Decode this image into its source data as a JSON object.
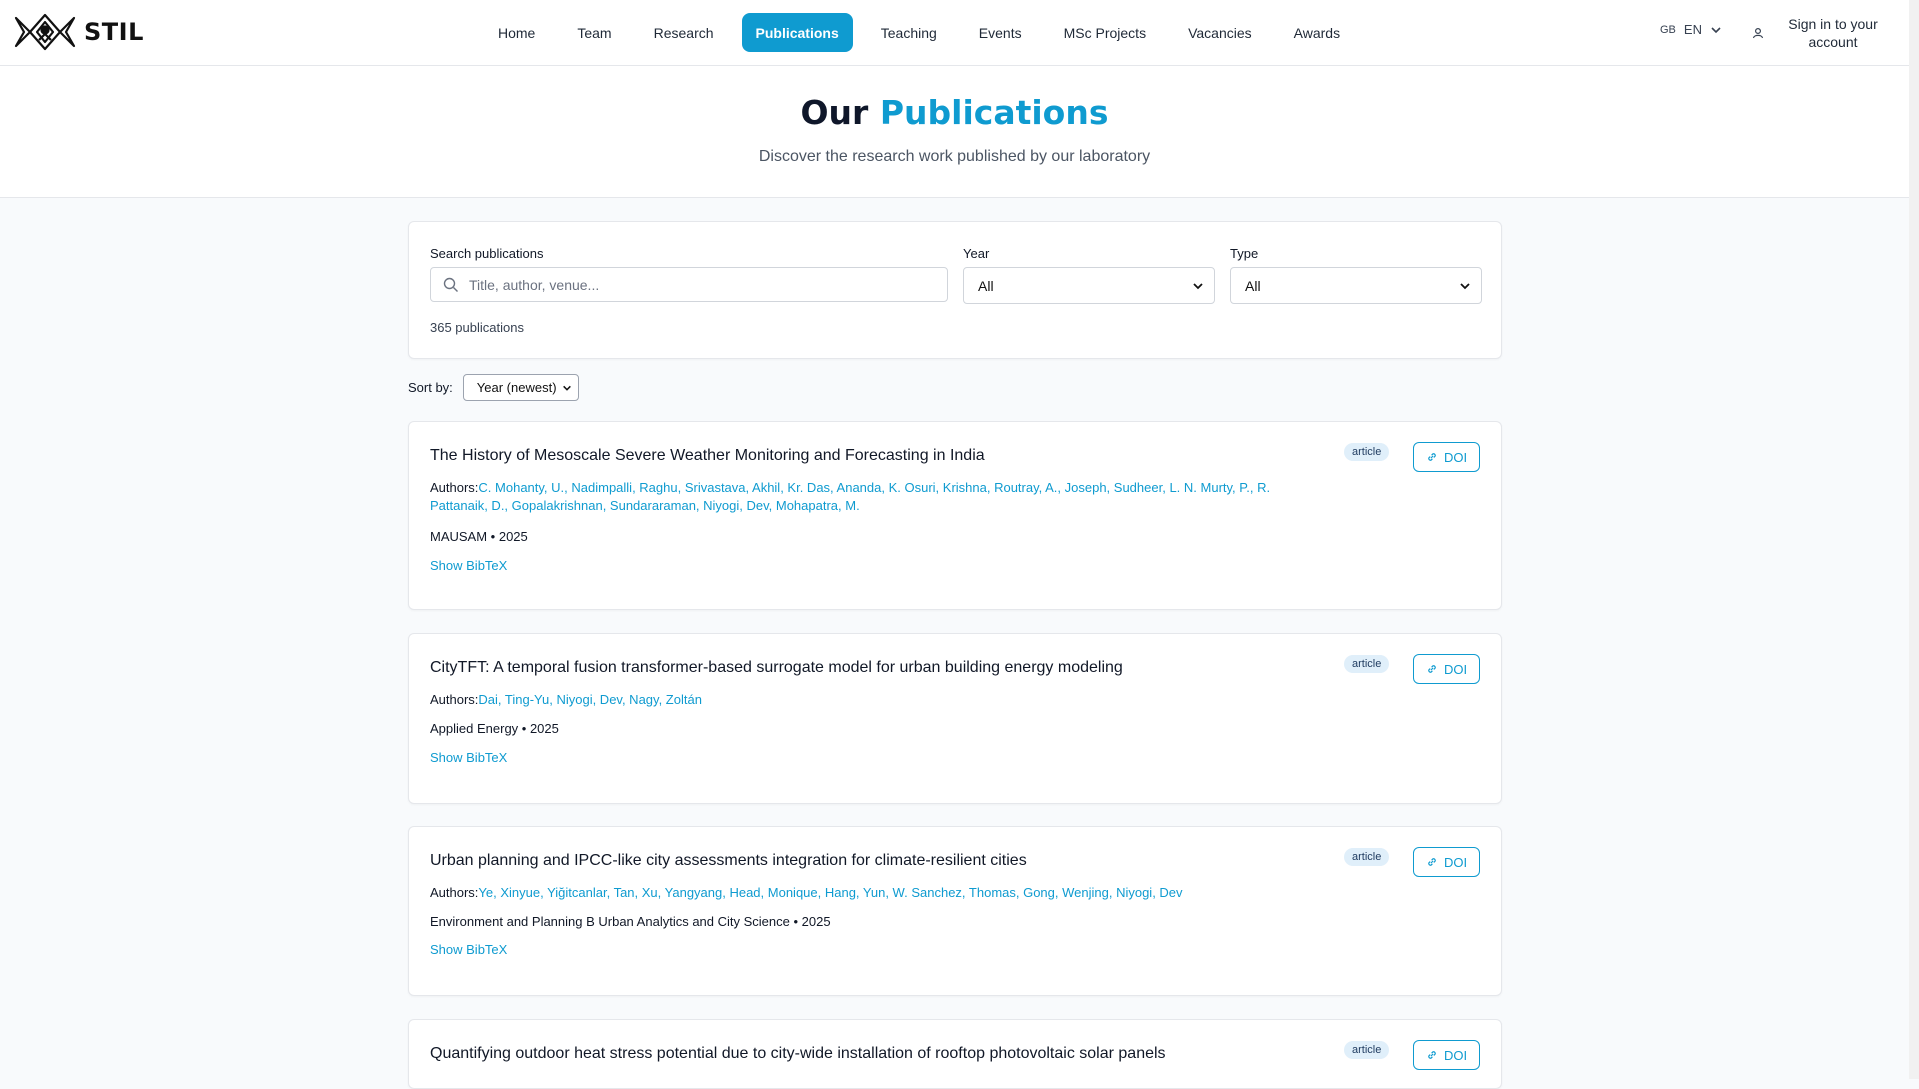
{
  "nav": {
    "brand": "STIL",
    "links": [
      "Home",
      "Team",
      "Research",
      "Publications",
      "Teaching",
      "Events",
      "MSc Projects",
      "Vacancies",
      "Awards"
    ],
    "active": "Publications",
    "lang_flag": "GB",
    "lang_code": "EN",
    "signin_line1": "Sign in to your",
    "signin_line2": "account"
  },
  "hero": {
    "title_prefix": "Our",
    "title_accent": "Publications",
    "subtitle": "Discover the research work published by our laboratory"
  },
  "filters": {
    "search_label": "Search publications",
    "search_placeholder": "Title, author, venue...",
    "year_label": "Year",
    "year_value": "All",
    "type_label": "Type",
    "type_value": "All",
    "count_text": "365 publications"
  },
  "sort": {
    "label": "Sort by:",
    "value": "Year (newest)"
  },
  "publications": [
    {
      "title": "The History of Mesoscale Severe Weather Monitoring and Forecasting in India",
      "authors_label": "Authors:",
      "authors": "C. Mohanty, U., Nadimpalli, Raghu, Srivastava, Akhil, Kr. Das, Ananda, K. Osuri, Krishna, Routray, A., Joseph, Sudheer, L. N. Murty, P., R. Pattanaik, D., Gopalakrishnan, Sundararaman, Niyogi, Dev, Mohapatra, M.",
      "venue": "MAUSAM • 2025",
      "bibtex": "Show BibTeX",
      "type": "article",
      "doi": "DOI"
    },
    {
      "title": "CityTFT: A temporal fusion transformer-based surrogate model for urban building energy modeling",
      "authors_label": "Authors:",
      "authors": "Dai, Ting-Yu, Niyogi, Dev, Nagy, Zoltán",
      "venue": "Applied Energy • 2025",
      "bibtex": "Show BibTeX",
      "type": "article",
      "doi": "DOI"
    },
    {
      "title": "Urban planning and IPCC-like city assessments integration for climate-resilient cities",
      "authors_label": "Authors:",
      "authors": "Ye, Xinyue, Yiğitcanlar, Tan, Xu, Yangyang, Head, Monique, Hang, Yun, W. Sanchez, Thomas, Gong, Wenjing, Niyogi, Dev",
      "venue": "Environment and Planning B Urban Analytics and City Science • 2025",
      "bibtex": "Show BibTeX",
      "type": "article",
      "doi": "DOI"
    },
    {
      "title": "Quantifying outdoor heat stress potential due to city-wide installation of rooftop photovoltaic solar panels",
      "type": "article",
      "doi": "DOI"
    }
  ]
}
